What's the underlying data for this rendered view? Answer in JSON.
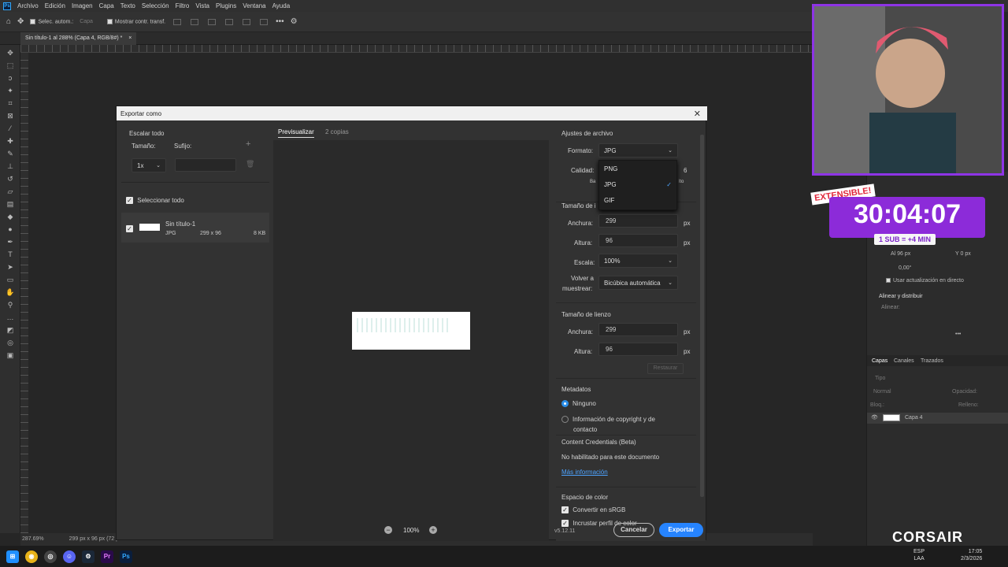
{
  "menubar": {
    "items": [
      "Archivo",
      "Edición",
      "Imagen",
      "Capa",
      "Texto",
      "Selección",
      "Filtro",
      "Vista",
      "Plugins",
      "Ventana",
      "Ayuda"
    ]
  },
  "options_bar": {
    "auto_select_label": "Selec. autom.:",
    "auto_select_value": "Capa",
    "show_transform_label": "Mostrar contr. transf."
  },
  "document_tab": {
    "title": "Sin título-1 al 288% (Capa 4, RGB/8#) *"
  },
  "status_bar": {
    "zoom": "287.69%",
    "dims": "299 px x 96 px (72 p"
  },
  "dialog": {
    "title": "Exportar como",
    "left": {
      "scale_all_label": "Escalar todo",
      "size_label": "Tamaño:",
      "suffix_label": "Sufijo:",
      "size_value": "1x",
      "select_all_label": "Seleccionar todo",
      "asset": {
        "name": "Sin título-1",
        "format": "JPG",
        "dims": "299 x 96",
        "filesize": "8 KB"
      }
    },
    "tabs": {
      "preview": "Previsualizar",
      "copies": "2 copias"
    },
    "preview_zoom": "100%",
    "version": "v5.12.11",
    "file_settings": {
      "heading": "Ajustes de archivo",
      "format_label": "Formato:",
      "format_value": "JPG",
      "quality_label": "Calidad:",
      "quality_value": "6",
      "quality_low": "Ba",
      "quality_high": "lto",
      "dropdown_options": [
        "PNG",
        "JPG",
        "GIF"
      ],
      "dropdown_selected": "JPG"
    },
    "image_size": {
      "heading": "Tamaño de i",
      "width_label": "Anchura:",
      "width_value": "299",
      "height_label": "Altura:",
      "height_value": "96",
      "unit": "px",
      "scale_label": "Escala:",
      "scale_value": "100%",
      "resample_label_1": "Volver a",
      "resample_label_2": "muestrear:",
      "resample_value": "Bicúbica automática"
    },
    "canvas_size": {
      "heading": "Tamaño de lienzo",
      "width_label": "Anchura:",
      "width_value": "299",
      "height_label": "Altura:",
      "height_value": "96",
      "unit": "px",
      "restore_label": "Restaurar"
    },
    "metadata": {
      "heading": "Metadatos",
      "option_none": "Ninguno",
      "option_copyright_1": "Información de copyright y de",
      "option_copyright_2": "contacto"
    },
    "content_credentials": {
      "heading": "Content Credentials (Beta)",
      "text": "No habilitado para este documento",
      "link": "Más información"
    },
    "color_space": {
      "heading": "Espacio de color",
      "convert_label": "Convertir en sRGB",
      "embed_label": "Incrustar perfil de color"
    },
    "buttons": {
      "cancel": "Cancelar",
      "export": "Exportar"
    }
  },
  "panels": {
    "w_field": "Al  96 px",
    "y_field": "Y  0 px",
    "angle": "0,00°",
    "live_update": "Usar actualización en directo",
    "align_heading": "Alinear y distribuir",
    "align_label": "Alinear:",
    "tabs": [
      "Capas",
      "Canales",
      "Trazados"
    ],
    "search_placeholder": "Tipo",
    "blend_mode": "Normal",
    "opacity_label": "Opacidad:",
    "lock_label": "Bloq.:",
    "fill_label": "Relleno:",
    "layer_name": "Capa 4"
  },
  "overlay": {
    "badge": "EXTENSIBLE!",
    "timer": "30:04:07",
    "sub_text": "1 SUB = +4 MIN",
    "brand": "CORSAIR"
  },
  "taskbar": {
    "lang_1": "ESP",
    "lang_2": "LAA",
    "time": "17:05",
    "date": "2/3/2026"
  }
}
